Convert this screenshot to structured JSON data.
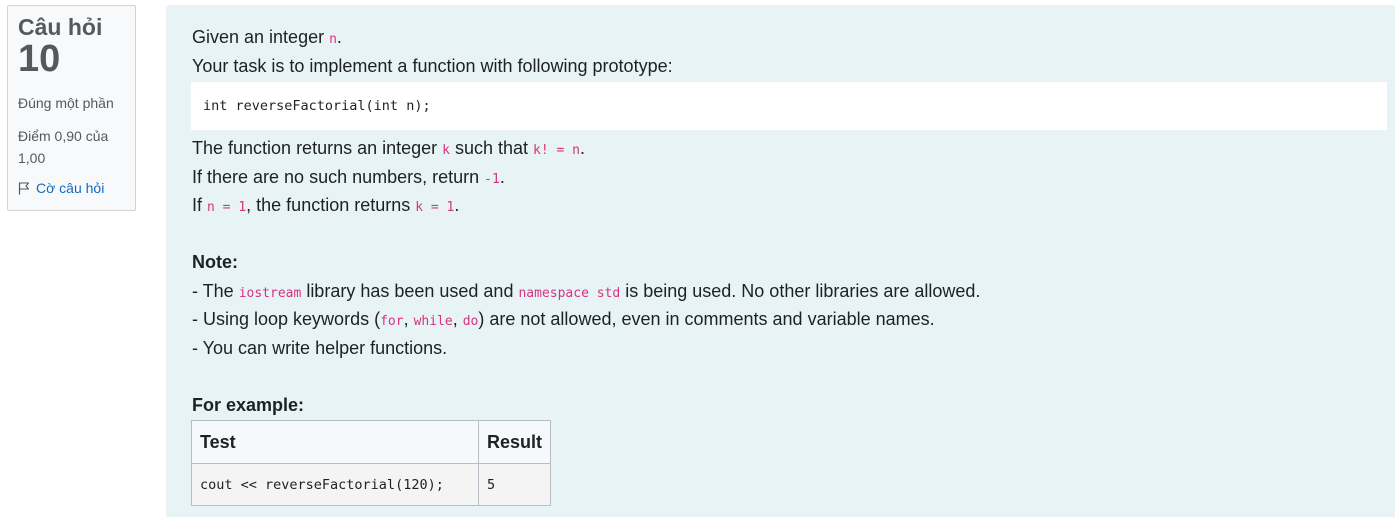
{
  "info": {
    "question_label": "Câu hỏi",
    "question_number": "10",
    "state": "Đúng một phần",
    "grade": "Điểm 0,90 của 1,00",
    "flag_label": "Cờ câu hỏi"
  },
  "question": {
    "line1_a": "Given an integer ",
    "line1_code": "n",
    "line1_b": ".",
    "line2": "Your task is to implement a function with following prototype:",
    "prototype": "int reverseFactorial(int n);",
    "line3_a": "The function returns an integer ",
    "line3_code1": "k",
    "line3_b": " such that ",
    "line3_code2": "k! = n",
    "line3_c": ".",
    "line4_a": "If there are no such numbers, return ",
    "line4_code": "-1",
    "line4_b": ".",
    "line5_a": "If ",
    "line5_code1": "n = 1",
    "line5_b": ", the function returns ",
    "line5_code2": "k = 1",
    "line5_c": ".",
    "note_heading": "Note:",
    "note1_a": "- The ",
    "note1_code1": "iostream",
    "note1_b": " library has been used and ",
    "note1_code2": "namespace std",
    "note1_c": " is being used. No other libraries are allowed.",
    "note2_a": "- Using loop keywords (",
    "note2_code1": "for",
    "note2_sep1": ", ",
    "note2_code2": "while",
    "note2_sep2": ", ",
    "note2_code3": "do",
    "note2_b": ") are not allowed, even in comments and variable names.",
    "note3": "- You can write helper functions.",
    "example_heading": "For example:"
  },
  "example_table": {
    "headers": [
      "Test",
      "Result"
    ],
    "rows": [
      [
        "cout << reverseFactorial(120);",
        "5"
      ]
    ]
  }
}
